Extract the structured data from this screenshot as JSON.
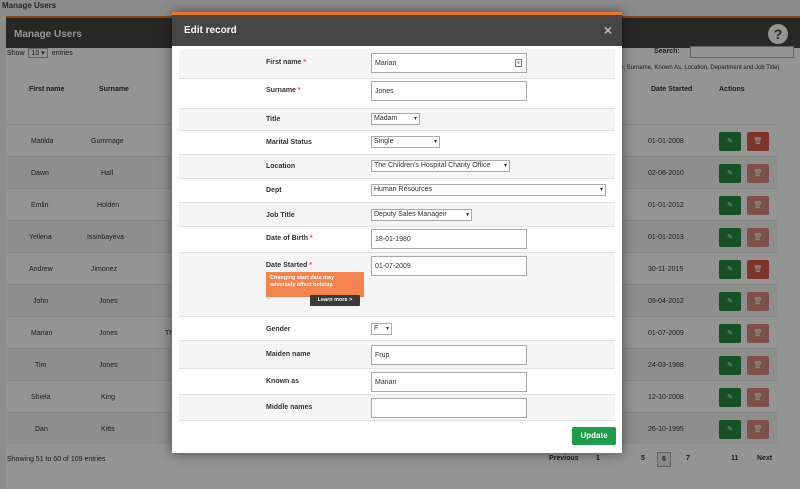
{
  "page": {
    "title": "Manage Users"
  },
  "panel": {
    "title": "Manage Users",
    "help_icon": "?"
  },
  "table_controls": {
    "show_label": "Show",
    "entries_value": "10",
    "entries_label": "entries",
    "search_label": "Search:",
    "search_hint": "e, Surname, Known As, Location, Department and Job Title)"
  },
  "table": {
    "headers": {
      "first_name": "First name",
      "surname": "Surname",
      "date_started": "Date Started",
      "actions": "Actions"
    },
    "rows": [
      {
        "first": "Matilda",
        "surname": "Gummage",
        "date": "01-01-2008"
      },
      {
        "first": "Dawn",
        "surname": "Hall",
        "date": "02-06-2010"
      },
      {
        "first": "Emlin",
        "surname": "Holden",
        "date": "01-01-2012"
      },
      {
        "first": "Yellena",
        "surname": "Issinbayeva",
        "date": "01-01-2013"
      },
      {
        "first": "Andrew",
        "surname": "Jimonez",
        "date": "30-11-2015"
      },
      {
        "first": "John",
        "surname": "Jones",
        "date": "09-04-2012"
      },
      {
        "first": "Marian",
        "surname": "Jones",
        "extra": "Th",
        "date": "01-07-2009"
      },
      {
        "first": "Tim",
        "surname": "Jones",
        "date": "24-03-1988"
      },
      {
        "first": "Shiela",
        "surname": "King",
        "date": "12-10-2008"
      },
      {
        "first": "Dan",
        "surname": "Kitts",
        "date": "26-10-1995"
      }
    ],
    "edit_icon": "✎",
    "delete_icon": "🗑"
  },
  "footer": {
    "info": "Showing 51 to 60 of 109 entries",
    "pager": {
      "previous": "Previous",
      "p1": "1",
      "p5": "5",
      "p6": "6",
      "p7": "7",
      "p11": "11",
      "next": "Next"
    }
  },
  "modal": {
    "title": "Edit record",
    "close": "×",
    "fields": {
      "first_name": {
        "label": "First name",
        "value": "Marian"
      },
      "surname": {
        "label": "Surname",
        "value": "Jones"
      },
      "title": {
        "label": "Title",
        "value": "Madam"
      },
      "marital": {
        "label": "Marital Status",
        "value": "Single"
      },
      "location": {
        "label": "Location",
        "value": "The Children's Hospital Charity Office"
      },
      "dept": {
        "label": "Dept",
        "value": "Human Resources"
      },
      "job_title": {
        "label": "Job Title",
        "value": "Deputy Sales Manageir"
      },
      "dob": {
        "label": "Date of Birth",
        "value": "18-01-1980"
      },
      "date_started": {
        "label": "Date Started",
        "value": "01-07-2009"
      },
      "gender": {
        "label": "Gender",
        "value": "F"
      },
      "maiden": {
        "label": "Maiden name",
        "value": "Frup"
      },
      "known_as": {
        "label": "Known as",
        "value": "Marian"
      },
      "middle": {
        "label": "Middle names",
        "value": ""
      }
    },
    "required_mark": "*",
    "tooltip": {
      "text": "Changing start date may adversely affect holiday.",
      "learn_more": "Learn more >"
    },
    "update_label": "Update"
  }
}
